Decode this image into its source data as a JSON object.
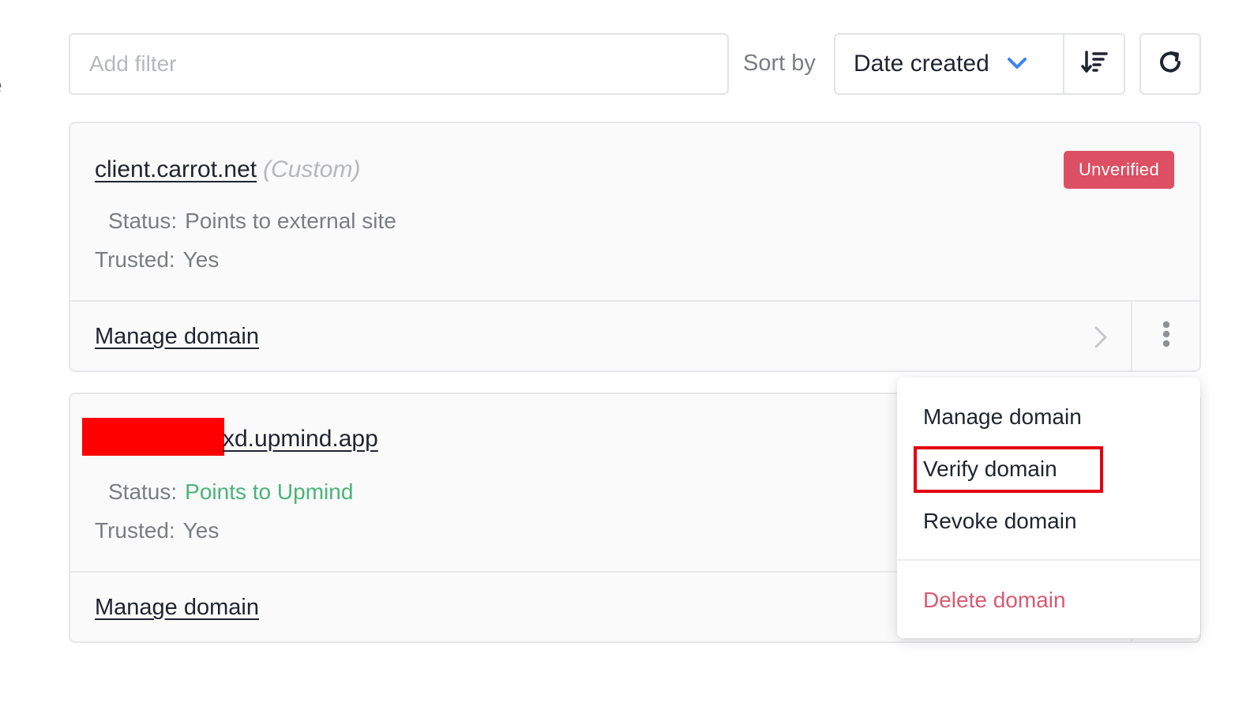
{
  "edge_fragment": "e",
  "toolbar": {
    "filter_placeholder": "Add filter",
    "sort_label": "Sort by",
    "sort_value": "Date created",
    "icons": {
      "sort_chevron": "chevron-down-icon",
      "sort_direction": "sort-descending-icon",
      "refresh": "refresh-icon"
    }
  },
  "domains": [
    {
      "name": "client.carrot.net",
      "type_label": "(Custom)",
      "badge": "Unverified",
      "status_label": "Status:",
      "status_value": "Points to external site",
      "trusted_label": "Trusted:",
      "trusted_value": "Yes",
      "footer_link": "Manage domain"
    },
    {
      "name": "xd.upmind.app",
      "status_label": "Status:",
      "status_value": "Points to Upmind",
      "trusted_label": "Trusted:",
      "trusted_value": "Yes",
      "footer_link": "Manage domain"
    }
  ],
  "menu": {
    "items": [
      "Manage domain",
      "Verify domain",
      "Revoke domain"
    ],
    "danger_item": "Delete domain"
  },
  "colors": {
    "badge_unverified": "#dd4f63",
    "status_ok": "#4bb37a",
    "danger": "#d95a73",
    "accent": "#3b82f6",
    "highlight": "#e3000f",
    "redaction": "#ff0000"
  }
}
